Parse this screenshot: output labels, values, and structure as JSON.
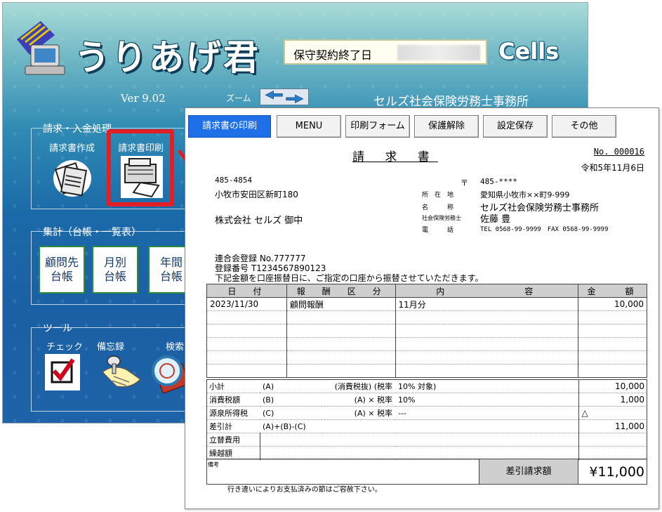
{
  "app": {
    "title": "うりあげ君",
    "contract_label": "保守契約終了日",
    "brand": "Cells",
    "version": "Ver 9.02",
    "zoom_label": "ズーム",
    "office_name": "セルズ社会保険労務士事務所",
    "groups": {
      "billing": {
        "title": "請求・入金処理",
        "create_label": "請求書作成",
        "print_label": "請求書印刷"
      },
      "totals": {
        "title": "集計（台帳・一覧表）",
        "buttons": [
          "顧問先\n台帳",
          "月別\n台帳",
          "年間\n台帳"
        ]
      },
      "tools": {
        "title": "ツール",
        "check_label": "チェック",
        "memo_label": "備忘録",
        "search_label": "検索"
      }
    }
  },
  "invoice": {
    "toolbar": {
      "print": "請求書の印刷",
      "menu": "MENU",
      "print_form": "印刷フォーム",
      "unprotect": "保護解除",
      "save_settings": "設定保存",
      "other": "その他"
    },
    "title": "請 求 書",
    "number": "No. 000016",
    "date": "令和5年11月6日",
    "recipient": {
      "postal": "485-4854",
      "address": "小牧市安田区新町180",
      "name": "株式会社 セルズ 御中"
    },
    "issuer": {
      "postal_mark": "〒",
      "postal": "485-****",
      "address_label": "所　在　地",
      "address": "愛知県小牧市××町9-999",
      "name_label": "名　　　称",
      "name": "セルズ社会保険労務士事務所",
      "title_label": "社会保険労務士",
      "person": "佐藤 豊",
      "phone_label": "電　　　話",
      "phone": "TEL 0568-99-9999　FAX 0568-99-9999"
    },
    "reg_no": "連合会登録 No.777777",
    "reg_id": "登録番号 T1234567890123",
    "transfer_note": "下記金額を口座振替日に、ご指定の口座から振替させていただきます。",
    "columns": [
      "日　付",
      "報　酬　区　分",
      "内　　　　　　容",
      "金　　額"
    ],
    "rows": [
      {
        "date": "2023/11/30",
        "category": "顧問報酬",
        "detail": "11月分",
        "amount": "10,000"
      },
      {
        "date": "",
        "category": "",
        "detail": "",
        "amount": ""
      },
      {
        "date": "",
        "category": "",
        "detail": "",
        "amount": ""
      },
      {
        "date": "",
        "category": "",
        "detail": "",
        "amount": ""
      },
      {
        "date": "",
        "category": "",
        "detail": "",
        "amount": ""
      },
      {
        "date": "",
        "category": "",
        "detail": "",
        "amount": ""
      }
    ],
    "summary": [
      {
        "label": "小計",
        "code": "(A)",
        "formula": "(消費税抜) (税率",
        "rate": "10% 対象)",
        "amount": "10,000"
      },
      {
        "label": "消費税額",
        "code": "(B)",
        "formula": "(A) × 税率",
        "rate": "10%",
        "amount": "1,000"
      },
      {
        "label": "源泉所得税",
        "code": "(C)",
        "formula": "(A) × 税率",
        "rate": "---",
        "amount": "△"
      },
      {
        "label": "差引計",
        "code": "(A)+(B)-(C)",
        "formula": "",
        "rate": "",
        "amount": "11,000"
      },
      {
        "label": "立替費用",
        "code": "",
        "formula": "",
        "rate": "",
        "amount": ""
      },
      {
        "label": "繰越額",
        "code": "",
        "formula": "",
        "rate": "",
        "amount": ""
      }
    ],
    "remarks_label": "備考",
    "total_label": "差引請求額",
    "total_value": "¥11,000",
    "footer": "行き違いによりお支払済みの節はご容赦下さい。"
  },
  "colors": {
    "highlight": "#e31e24",
    "primary_button": "#1f6fe8",
    "ledger_border": "#2a8a3a"
  }
}
